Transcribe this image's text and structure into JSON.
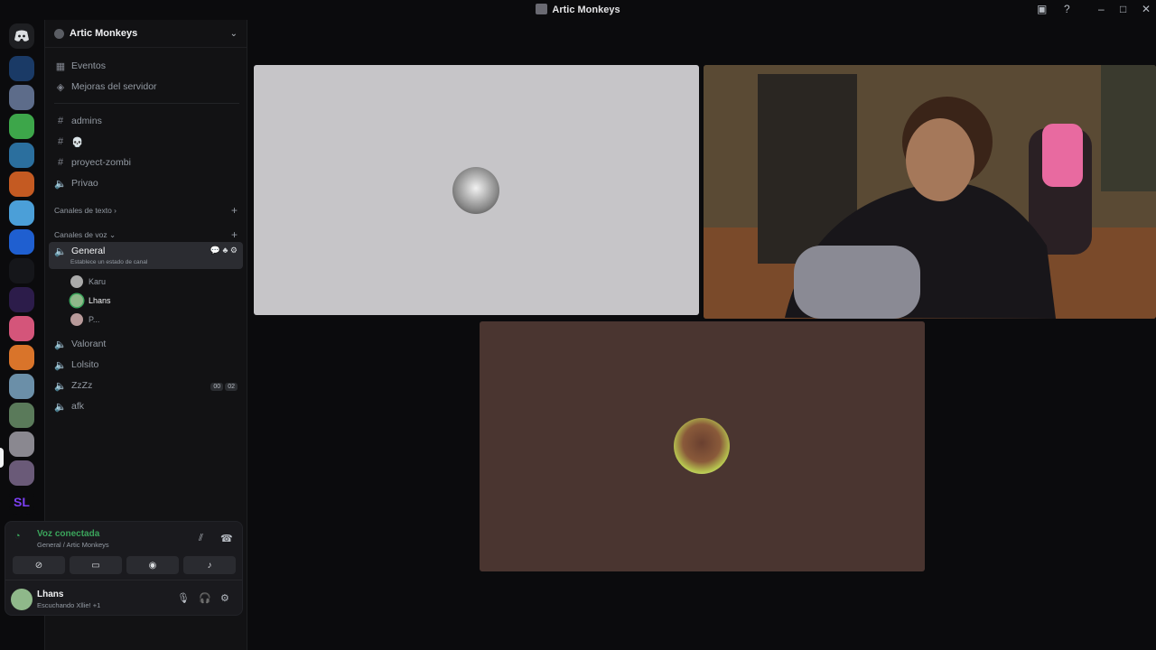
{
  "window": {
    "title": "Artic Monkeys"
  },
  "guild": {
    "name": "Artic Monkeys"
  },
  "top_items": [
    {
      "label": "Eventos",
      "icon": "calendar-icon"
    },
    {
      "label": "Mejoras del servidor",
      "icon": "boost-icon"
    }
  ],
  "channels": [
    {
      "label": "admins",
      "type": "text"
    },
    {
      "label": "💀",
      "type": "text"
    },
    {
      "label": "proyect-zombi",
      "type": "text"
    },
    {
      "label": "Privao",
      "type": "voice"
    }
  ],
  "categories": {
    "text": "Canales de texto",
    "voice": "Canales de voz"
  },
  "voice_channels": {
    "active": {
      "label": "General",
      "status": "Establece un estado de canal"
    },
    "members": [
      {
        "name": "Karu",
        "color": "#aaaaaa"
      },
      {
        "name": "Lhans",
        "color": "#8fb88a"
      },
      {
        "name": "P...",
        "color": "#b89a9a"
      }
    ],
    "others": [
      {
        "label": "Valorant"
      },
      {
        "label": "Lolsito"
      },
      {
        "label": "ZzZz",
        "badge_a": "00",
        "badge_b": "02"
      },
      {
        "label": "afk"
      }
    ]
  },
  "voice_panel": {
    "title": "Voz conectada",
    "subtitle": "General / Artic Monkeys"
  },
  "user": {
    "name": "Lhans",
    "status": "Escuchando Xllie! +1"
  },
  "colors": {
    "accent_green": "#3ba55c",
    "background": "#0b0b0d",
    "sidebar": "#121214"
  }
}
